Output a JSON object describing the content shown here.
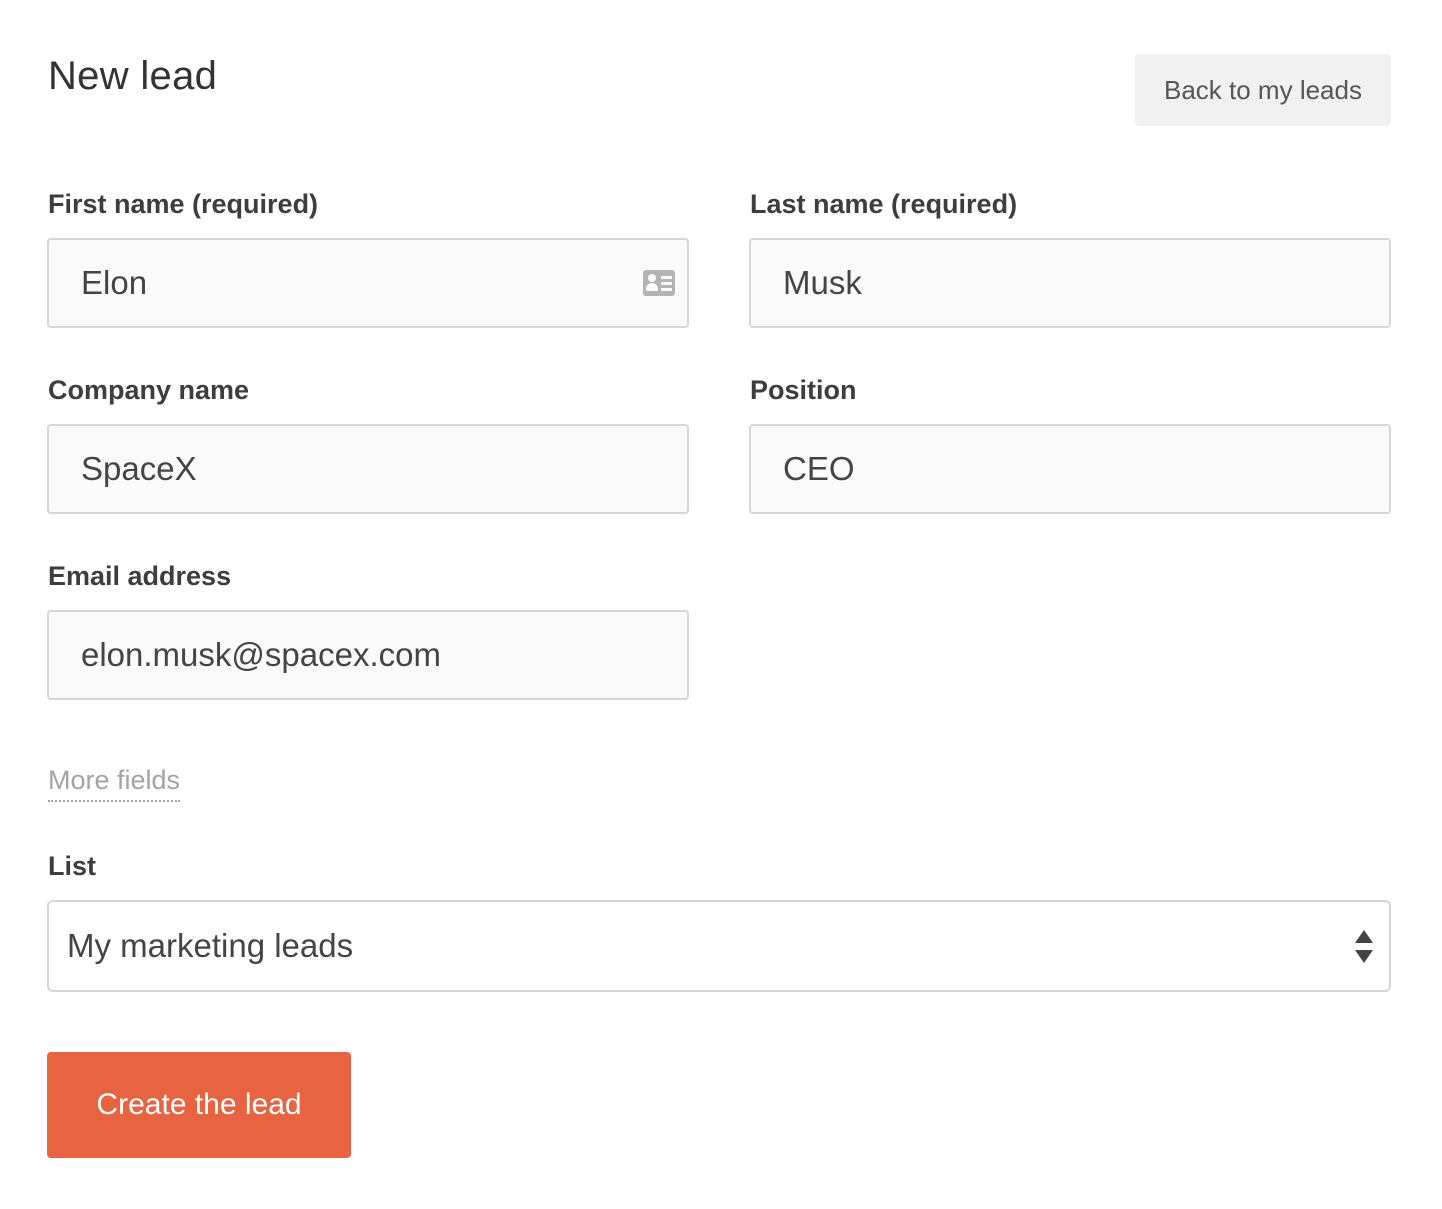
{
  "header": {
    "title": "New lead",
    "back_label": "Back to my leads"
  },
  "form": {
    "first_name": {
      "label": "First name (required)",
      "value": "Elon"
    },
    "last_name": {
      "label": "Last name (required)",
      "value": "Musk"
    },
    "company": {
      "label": "Company name",
      "value": "SpaceX"
    },
    "position": {
      "label": "Position",
      "value": "CEO"
    },
    "email": {
      "label": "Email address",
      "value": "elon.musk@spacex.com"
    },
    "more_fields_label": "More fields",
    "list": {
      "label": "List",
      "selected": "My marketing leads"
    },
    "submit_label": "Create the lead"
  },
  "icons": {
    "first_name_field": "contact-card-icon",
    "list_select": "select-arrows-icon"
  },
  "colors": {
    "primary": "#e86440",
    "secondary_button_bg": "#f1f1f1",
    "field_border": "#d6d6d6",
    "link_muted": "#a3a3a3"
  }
}
